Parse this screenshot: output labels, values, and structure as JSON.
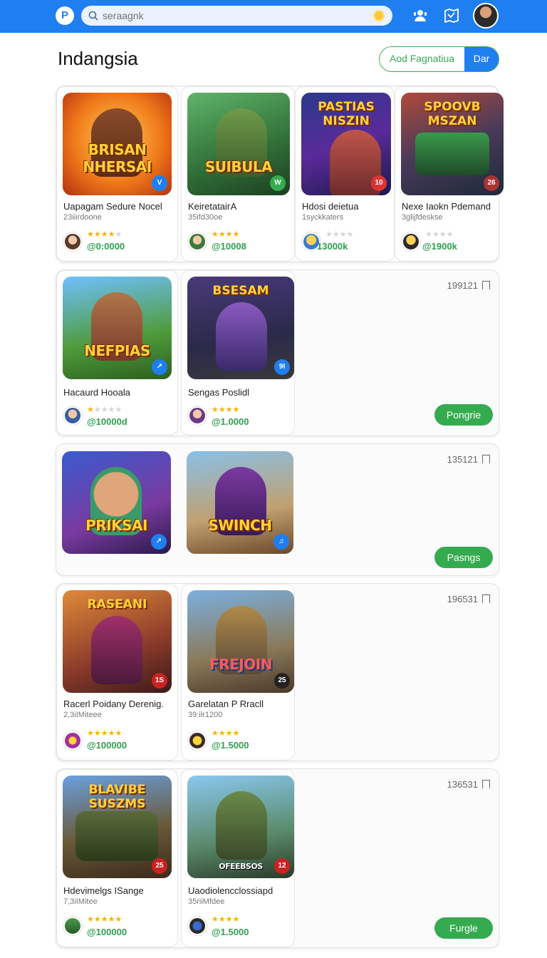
{
  "header": {
    "logo": "P",
    "search_placeholder": "seraagnk"
  },
  "page": {
    "title": "Indangsia",
    "add_button": "Aod Fagnatiua",
    "dar_button": "Dar"
  },
  "cards": [
    {
      "tiles": [
        {
          "name": "Uapagam Sedure Nocel",
          "sub": "23iiirdoone",
          "rating": 4,
          "price": "@0:0000",
          "art": "BRISAN NHERSAI",
          "badge": "V"
        },
        {
          "name": "KeiretataiгA",
          "sub": "35ifd30oe",
          "rating": 4,
          "price": "@10008",
          "art": "SUIBULA",
          "badge": "W"
        },
        {
          "name": "Hdosi deietua",
          "sub": "1syckkaters",
          "rating": 0,
          "price": "13000k",
          "art": "PASTIAS NISZIN",
          "badge": "10"
        },
        {
          "name": "Nexe Iaokn Pdemand",
          "sub": "3glijfdeskse",
          "rating": 0,
          "price": "@1900k",
          "art": "SPOOVB MSZAN",
          "badge": "26"
        }
      ]
    },
    {
      "meta": "199121",
      "button": "Pongrie",
      "tiles": [
        {
          "name": "Hacaurd Hooala",
          "rating": 1,
          "price": "@10000d",
          "art": "NEFPIAS",
          "badge": "↗"
        },
        {
          "name": "Sengas Poslidl",
          "rating": 4,
          "price": "@1.0000",
          "art": "BSESAM",
          "badge": "9I"
        }
      ]
    },
    {
      "meta": "135121",
      "button": "Pasngs",
      "tiles": [
        {
          "art": "PRIKSAI",
          "badge": "↗"
        },
        {
          "art": "SWINCH",
          "badge": "♫"
        }
      ]
    },
    {
      "meta": "196531",
      "tiles": [
        {
          "name": "Racerl Poidany Derenig.",
          "sub": "2,3iIMiteee",
          "rating": 5,
          "price": "@100000",
          "art": "RASEANI",
          "badge": "1S"
        },
        {
          "name": "Garelatan P Rracll",
          "sub": "39:ilr1200",
          "rating": 4,
          "price": "@1.5000",
          "art": "FREJOIN",
          "badge": "25"
        }
      ]
    },
    {
      "meta": "136531",
      "button": "Furgle",
      "tiles": [
        {
          "name": "Hdevimelgs ISange",
          "sub": "7,3iIMitee",
          "rating": 5,
          "price": "@100000",
          "art": "BLAVIBE SUSZMS",
          "badge": "25"
        },
        {
          "name": "Uaodiolencclossiapd",
          "sub": "35riiMfdee",
          "rating": 4,
          "price": "@1.5000",
          "art": "OFEEBSOS",
          "badge": "12"
        }
      ]
    }
  ],
  "colors": {
    "brand_blue": "#1f7ff0",
    "accent_green": "#35ab4f",
    "star": "#f4b400"
  },
  "icons": [
    "search-icon",
    "mic-icon",
    "support-agent-icon",
    "map-icon",
    "bookmark-icon"
  ]
}
